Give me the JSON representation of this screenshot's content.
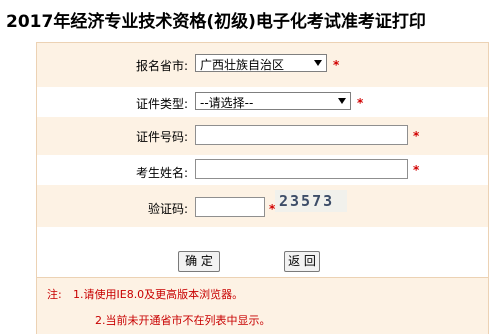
{
  "page": {
    "title": "2017年经济专业技术资格(初级)电子化考试准考证打印"
  },
  "form": {
    "province": {
      "label": "报名省市:",
      "selected": "广西壮族自治区"
    },
    "id_type": {
      "label": "证件类型:",
      "selected": "--请选择--"
    },
    "id_number": {
      "label": "证件号码:",
      "value": ""
    },
    "name": {
      "label": "考生姓名:",
      "value": ""
    },
    "captcha": {
      "label": "验证码:",
      "value": "",
      "image_text": "23573"
    },
    "required_mark": "*"
  },
  "buttons": {
    "confirm": "确 定",
    "back": "返 回"
  },
  "notes": {
    "prefix": "注:",
    "line1": "1.请使用IE8.0及更高版本浏览器。",
    "line2": "2.当前未开通省市不在列表中显示。"
  },
  "colors": {
    "accent_red": "#d10000",
    "row_shade": "#fdf2e4",
    "border": "#ecd2b4"
  }
}
